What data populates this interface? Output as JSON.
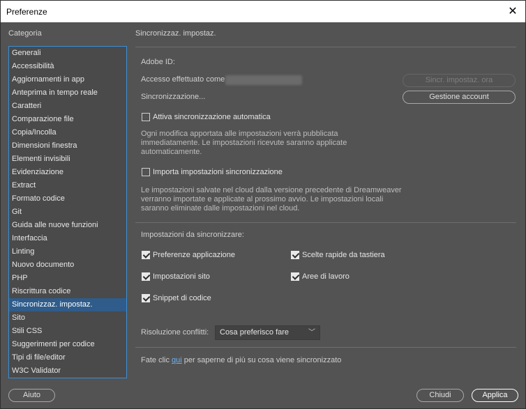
{
  "window": {
    "title": "Preferenze"
  },
  "sidebar": {
    "label": "Categoria",
    "items": [
      "Generali",
      "Accessibilità",
      "Aggiornamenti in app",
      "Anteprima in tempo reale",
      "Caratteri",
      "Comparazione file",
      "Copia/Incolla",
      "Dimensioni finestra",
      "Elementi invisibili",
      "Evidenziazione",
      "Extract",
      "Formato codice",
      "Git",
      "Guida alle nuove funzioni",
      "Interfaccia",
      "Linting",
      "Nuovo documento",
      "PHP",
      "Riscrittura codice",
      "Sincronizzaz. impostaz.",
      "Sito",
      "Stili CSS",
      "Suggerimenti per codice",
      "Tipi di file/editor",
      "W3C Validator"
    ],
    "selected_index": 19
  },
  "main": {
    "title": "Sincronizzaz. impostaz.",
    "adobe_id_label": "Adobe ID:",
    "access_label": "Accesso effettuato come",
    "sync_status": "Sincronizzazione...",
    "sync_now_button": "Sincr. impostaz. ora",
    "manage_account_button": "Gestione account",
    "auto_sync": {
      "label": "Attiva sincronizzazione automatica",
      "checked": false
    },
    "auto_sync_desc_1": "Ogni modifica apportata alle impostazioni verrà pubblicata",
    "auto_sync_desc_2": "immediatamente. Le impostazioni ricevute saranno applicate",
    "auto_sync_desc_3": "automaticamente.",
    "import_sync": {
      "label": "Importa impostazioni sincronizzazione",
      "checked": false
    },
    "import_desc_1": "Le impostazioni salvate nel cloud dalla versione precedente di Dreamweaver",
    "import_desc_2": "verranno importate e applicate al prossimo avvio. Le impostazioni locali",
    "import_desc_3": "saranno eliminate dalle impostazioni nel cloud.",
    "settings_to_sync_label": "Impostazioni da sincronizzare:",
    "options": {
      "app_prefs": {
        "label": "Preferenze applicazione",
        "checked": true
      },
      "shortcuts": {
        "label": "Scelte rapide da tastiera",
        "checked": true
      },
      "site_settings": {
        "label": "Impostazioni sito",
        "checked": true
      },
      "workspaces": {
        "label": "Aree di lavoro",
        "checked": true
      },
      "snippets": {
        "label": "Snippet di codice",
        "checked": true
      }
    },
    "conflict_label": "Risoluzione conflitti:",
    "conflict_value": "Cosa preferisco fare",
    "footer_prefix": "Fate clic ",
    "footer_link": "qui",
    "footer_suffix": " per saperne di più su cosa viene sincronizzato"
  },
  "buttons": {
    "help": "Aiuto",
    "close": "Chiudi",
    "apply": "Applica"
  },
  "colors": {
    "background": "#535353",
    "selection": "#2f5c8a",
    "list_border": "#3a8fd8",
    "link": "#6fb0f0"
  }
}
